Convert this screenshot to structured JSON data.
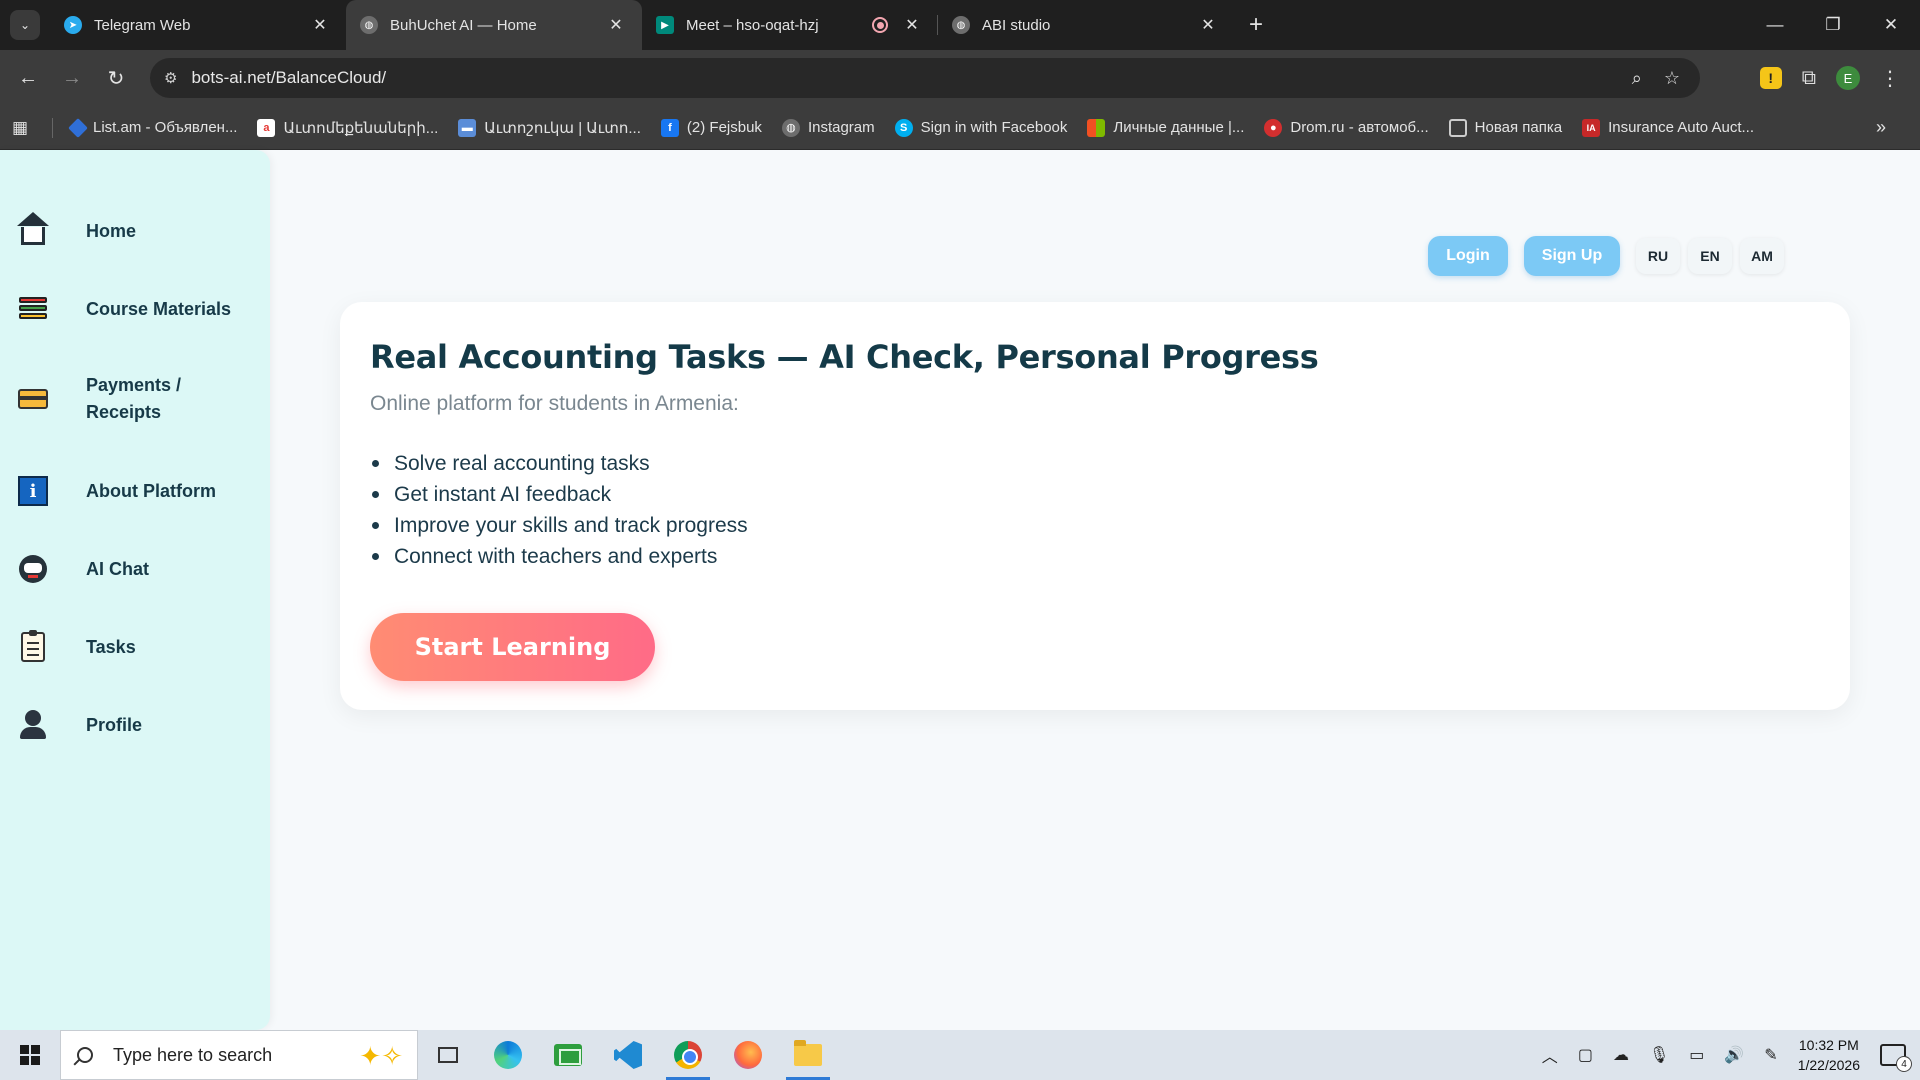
{
  "browser": {
    "tabs": [
      {
        "title": "Telegram Web",
        "favicon": "telegram-icon",
        "color": "#2AABEE"
      },
      {
        "title": "BuhUchet AI — Home",
        "favicon": "globe-icon",
        "color": "#777777"
      },
      {
        "title": "Meet – hso-oqat-hzj",
        "favicon": "google-meet-icon",
        "color": "#00897B"
      },
      {
        "title": "ABI studio",
        "favicon": "globe-icon",
        "color": "#777777"
      }
    ],
    "active_tab_index": 1,
    "url": "bots-ai.net/BalanceCloud/",
    "profile_initial": "E",
    "bookmarks": [
      {
        "label": "List.am - Объявлен...",
        "icon": "list-am-icon",
        "color": "#2f6fd8"
      },
      {
        "label": "Աւտոմեքենաների...",
        "icon": "auto-am-icon",
        "color": "#e53935"
      },
      {
        "label": "Աւտոշուկա | Աւտո...",
        "icon": "car-icon",
        "color": "#5b8dd8"
      },
      {
        "label": "(2) Fejsbuk",
        "icon": "facebook-icon",
        "color": "#1877f2"
      },
      {
        "label": "Instagram",
        "icon": "globe-icon",
        "color": "#777777"
      },
      {
        "label": "Sign in with Facebook",
        "icon": "skype-icon",
        "color": "#00aff0"
      },
      {
        "label": "Личные данные |...",
        "icon": "microsoft-icon",
        "color": "#f25022"
      },
      {
        "label": "Drom.ru - автомоб...",
        "icon": "drom-icon",
        "color": "#d32f2f"
      },
      {
        "label": "Новая папка",
        "icon": "folder-icon",
        "color": "#cccccc"
      },
      {
        "label": "Insurance Auto Auct...",
        "icon": "iaa-icon",
        "color": "#c62828"
      }
    ]
  },
  "sidebar": {
    "items": [
      {
        "label": "Home",
        "icon": "home-icon"
      },
      {
        "label": "Course Materials",
        "icon": "books-icon"
      },
      {
        "label": "Payments / Receipts",
        "icon": "credit-card-icon"
      },
      {
        "label": "About Platform",
        "icon": "info-icon"
      },
      {
        "label": "AI Chat",
        "icon": "robot-icon"
      },
      {
        "label": "Tasks",
        "icon": "clipboard-icon"
      },
      {
        "label": "Profile",
        "icon": "user-icon"
      }
    ]
  },
  "header": {
    "login_label": "Login",
    "signup_label": "Sign Up",
    "languages": [
      "RU",
      "EN",
      "AM"
    ]
  },
  "hero": {
    "title": "Real Accounting Tasks — AI Check, Personal Progress",
    "subtitle": "Online platform for students in Armenia:",
    "features": [
      "Solve real accounting tasks",
      "Get instant AI feedback",
      "Improve your skills and track progress",
      "Connect with teachers and experts"
    ],
    "cta_label": "Start Learning"
  },
  "taskbar": {
    "search_placeholder": "Type here to search",
    "time": "10:32 PM",
    "date": "1/22/2026",
    "notification_count": "4"
  },
  "colors": {
    "sidebar_bg": "#dcf8f6",
    "accent_blue": "#7cc9f5",
    "cta_gradient_start": "#ff8c73",
    "cta_gradient_end": "#ff6b87",
    "title_color": "#143a48"
  }
}
